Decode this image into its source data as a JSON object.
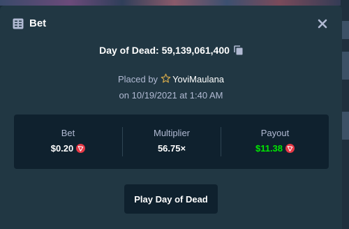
{
  "modal": {
    "title": "Bet",
    "game_title": "Day of Dead: 59,139,061,400",
    "placed_by_prefix": "Placed by",
    "username": "YoviMaulana",
    "placed_on": "on 10/19/2021 at 1:40 AM"
  },
  "stats": {
    "bet_label": "Bet",
    "bet_value": "$0.20",
    "multiplier_label": "Multiplier",
    "multiplier_value": "56.75×",
    "payout_label": "Payout",
    "payout_value": "$11.38"
  },
  "actions": {
    "play_label": "Play Day of Dead"
  },
  "icons": {
    "header": "bet-slip-icon",
    "close": "close-icon",
    "copy": "copy-icon",
    "vip": "star-icon",
    "currency": "tron-coin-icon"
  },
  "colors": {
    "modal_bg": "#213743",
    "panel_bg": "#0f212e",
    "text_muted": "#b1bad3",
    "payout_green": "#00e701",
    "coin_red": "#e63946"
  }
}
